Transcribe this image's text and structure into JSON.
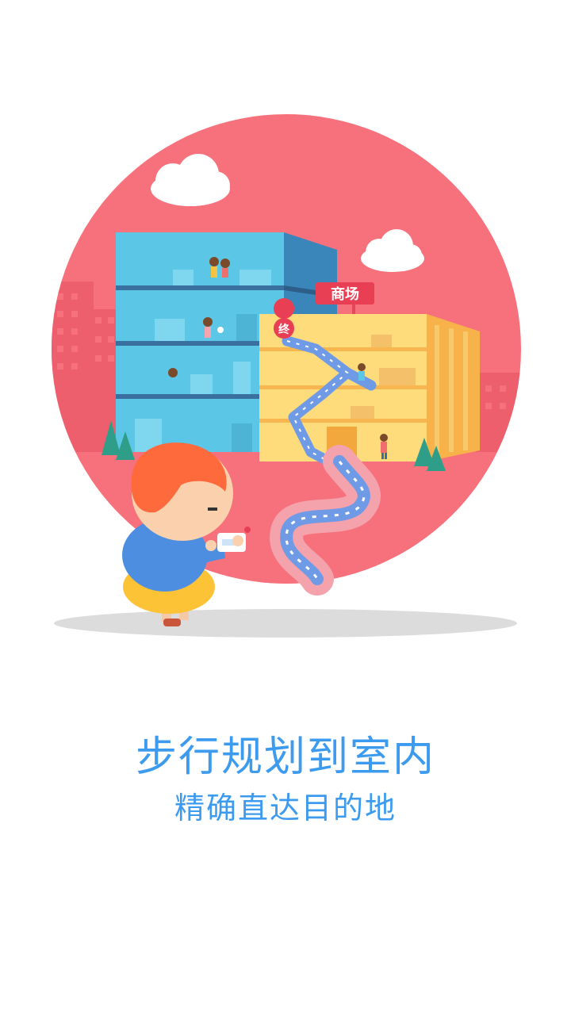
{
  "illustration": {
    "mall_sign": "商场",
    "end_marker": "终"
  },
  "headline": "步行规划到室内",
  "subline": "精确直达目的地",
  "colors": {
    "background": "#ffffff",
    "circle": "#f7717d",
    "text": "#3d9bef",
    "office_building": "#5bc6e6",
    "mall_building": "#fedc7c",
    "route": "#6f9ae6"
  }
}
